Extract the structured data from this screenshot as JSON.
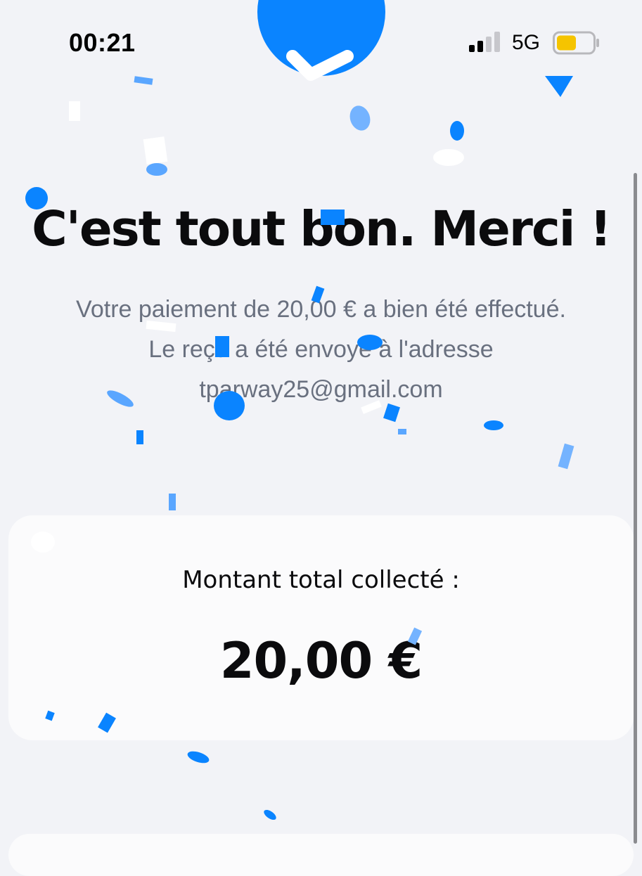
{
  "status_bar": {
    "time": "00:21",
    "network": "5G",
    "signal_bars_active": 2,
    "signal_bars_total": 4,
    "battery_level": 0.55,
    "battery_color": "#f5c400"
  },
  "colors": {
    "accent": "#0a84ff",
    "background": "#f2f3f7",
    "card": "#fbfbfc",
    "title_text": "#0b0b0d",
    "message_text": "#69707f"
  },
  "badge": {
    "icon": "checkmark-icon"
  },
  "confirmation": {
    "title": "C'est tout bon. Merci !",
    "message_line_1": "Votre paiement de 20,00 € a bien été effectué.",
    "message_line_2": "Le reçu a été envoyé à l'adresse",
    "email": "tparway25@gmail.com"
  },
  "total_card": {
    "label": "Montant total collecté :",
    "amount": "20,00 €"
  }
}
